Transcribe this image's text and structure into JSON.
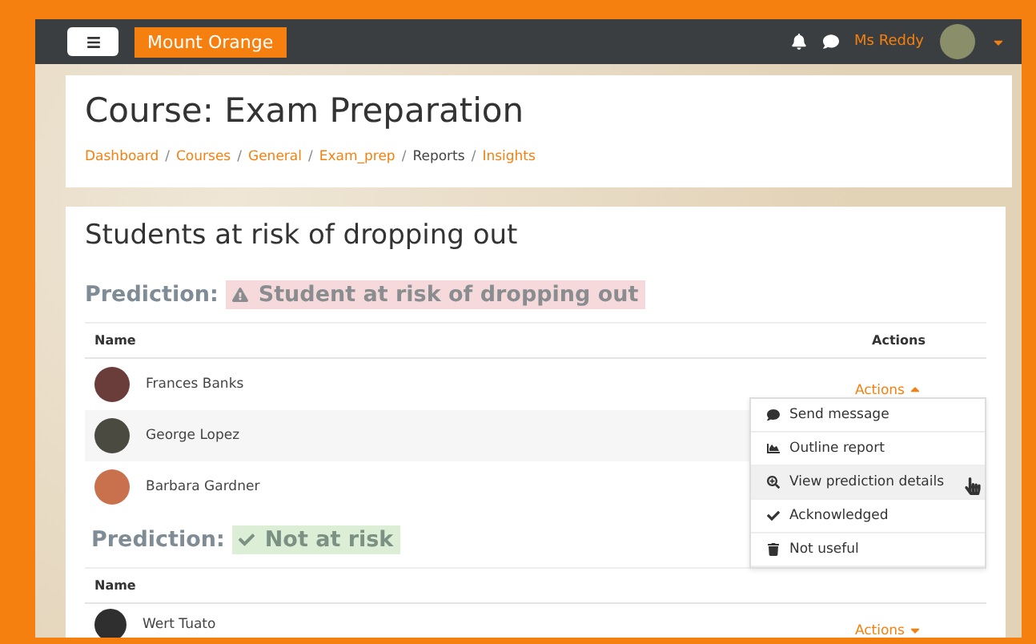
{
  "navbar": {
    "site_name": "Mount Orange",
    "user_name": "Ms Reddy"
  },
  "header": {
    "title": "Course: Exam Preparation",
    "separator": "/",
    "breadcrumbs": [
      {
        "label": "Dashboard",
        "link": true
      },
      {
        "label": "Courses",
        "link": true
      },
      {
        "label": "General",
        "link": true
      },
      {
        "label": "Exam_prep",
        "link": true
      },
      {
        "label": "Reports",
        "link": false
      },
      {
        "label": "Insights",
        "link": true
      }
    ]
  },
  "report": {
    "title": "Students at risk of dropping out",
    "predictions": [
      {
        "label": "Prediction:",
        "outcome": "Student at risk of dropping out",
        "kind": "risk",
        "columns": [
          "Name",
          "Actions"
        ],
        "rows": [
          {
            "name": "Frances Banks",
            "action": "Actions",
            "expanded": true
          },
          {
            "name": "George Lopez"
          },
          {
            "name": "Barbara Gardner"
          }
        ]
      },
      {
        "label": "Prediction:",
        "outcome": "Not at risk",
        "kind": "safe",
        "columns": [
          "Name"
        ],
        "rows": [
          {
            "name": "Wert Tuato",
            "action": "Actions",
            "expanded": false
          }
        ]
      }
    ]
  },
  "action_menu": [
    {
      "label": "Send message",
      "kind": "message",
      "highlighted": false
    },
    {
      "label": "Outline report",
      "kind": "report",
      "highlighted": false
    },
    {
      "label": "View prediction details",
      "kind": "details",
      "highlighted": true
    },
    {
      "label": "Acknowledged",
      "kind": "ack",
      "highlighted": false
    },
    {
      "label": "Not useful",
      "kind": "useless",
      "highlighted": false
    }
  ]
}
